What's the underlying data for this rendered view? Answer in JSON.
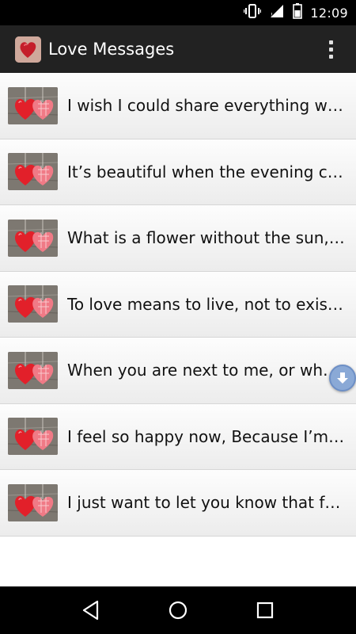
{
  "status_bar": {
    "time": "12:09",
    "icons": [
      "vibrate-icon",
      "signal-icon",
      "battery-icon"
    ]
  },
  "app_bar": {
    "title": "Love Messages",
    "icon": "hearts-app-icon",
    "overflow_icon": "more-vert-icon"
  },
  "messages": [
    {
      "text": "I wish I could share everything wit…"
    },
    {
      "text": "It’s beautiful when the evening co…"
    },
    {
      "text": "What is a flower without the sun, …"
    },
    {
      "text": "To love means to live, not to exist,…"
    },
    {
      "text": "When you are next to me, or when…"
    },
    {
      "text": "I feel so happy now, Because I’m …"
    },
    {
      "text": "I just want to let you know that fal…"
    }
  ],
  "scroll_button": {
    "icon": "scroll-down-icon"
  },
  "nav_bar": {
    "icons": [
      "back-icon",
      "home-icon",
      "recents-icon"
    ]
  },
  "colors": {
    "status_bar": "#000000",
    "app_bar": "#222222",
    "list_bg": "#f4f4f4",
    "heart_red": "#e2202a",
    "heart_pink": "#f07a86",
    "fab": "#8aa9d6"
  }
}
